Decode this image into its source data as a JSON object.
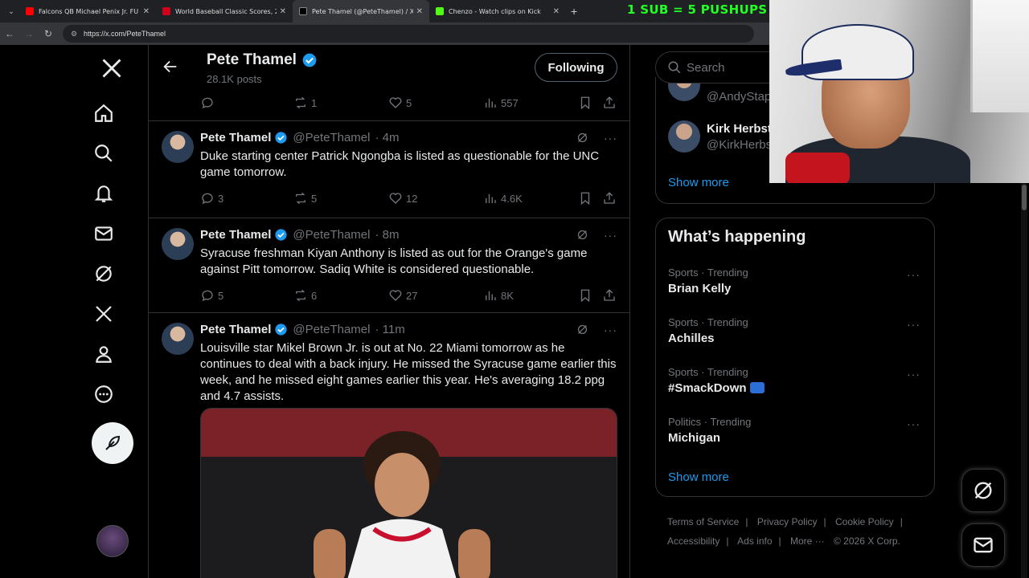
{
  "browser": {
    "tabs": [
      {
        "label": "Falcons QB Michael Penix Jr. FU",
        "favicon_color": "#ff0000"
      },
      {
        "label": "World Baseball Classic Scores, 2",
        "favicon_color": "#d0021b"
      },
      {
        "label": "Pete Thamel (@PeteThamel) / X",
        "favicon_color": "#000000",
        "active": true
      },
      {
        "label": "Chenzo - Watch clips on Kick",
        "favicon_color": "#53fc18"
      }
    ],
    "url": "https://x.com/PeteThamel"
  },
  "overlay": {
    "promo_text": "1 SUB = 5 PUSHUPS"
  },
  "profile_header": {
    "name": "Pete Thamel",
    "posts": "28.1K posts",
    "follow_label": "Following"
  },
  "partial_tweet": {
    "replies": "",
    "reposts": "1",
    "likes": "5",
    "views": "557"
  },
  "tweets": [
    {
      "name": "Pete Thamel",
      "handle": "@PeteThamel",
      "time": "· 4m",
      "text": "Duke starting center Patrick Ngongba is listed as questionable for the UNC game tomorrow.",
      "replies": "3",
      "reposts": "5",
      "likes": "12",
      "views": "4.6K"
    },
    {
      "name": "Pete Thamel",
      "handle": "@PeteThamel",
      "time": "· 8m",
      "text": "Syracuse freshman Kiyan Anthony is listed as out for the Orange's game against Pitt tomorrow. Sadiq White is considered questionable.",
      "replies": "5",
      "reposts": "6",
      "likes": "27",
      "views": "8K"
    },
    {
      "name": "Pete Thamel",
      "handle": "@PeteThamel",
      "time": "· 11m",
      "text": "Louisville star Mikel Brown Jr. is out at No. 22 Miami tomorrow as he continues to deal with a back injury. He missed the Syracuse game earlier this week, and he missed eight games earlier this year. He's averaging 18.2 ppg and 4.7 assists."
    }
  ],
  "sidebar": {
    "search_placeholder": "Search",
    "who_to_follow": [
      {
        "name": "",
        "handle": "@AndyStap"
      },
      {
        "name": "Kirk Herbst",
        "handle": "@KirkHerbs"
      }
    ],
    "show_more": "Show more",
    "happening_title": "What’s happening",
    "trends": [
      {
        "context": "Sports · Trending",
        "topic": "Brian Kelly"
      },
      {
        "context": "Sports · Trending",
        "topic": "Achilles"
      },
      {
        "context": "Sports · Trending",
        "topic": "#SmackDown"
      },
      {
        "context": "Politics · Trending",
        "topic": "Michigan"
      }
    ],
    "show_more_2": "Show more",
    "footer": {
      "terms": "Terms of Service",
      "privacy": "Privacy Policy",
      "cookie": "Cookie Policy",
      "accessibility": "Accessibility",
      "ads": "Ads info",
      "more": "More ···",
      "copyright": "© 2026 X Corp."
    }
  },
  "colors": {
    "accent": "#1d9bf0",
    "verified": "#1d9bf0",
    "background": "#000000",
    "border": "#2f3336",
    "muted": "#71767b",
    "promo": "#22ff22"
  }
}
